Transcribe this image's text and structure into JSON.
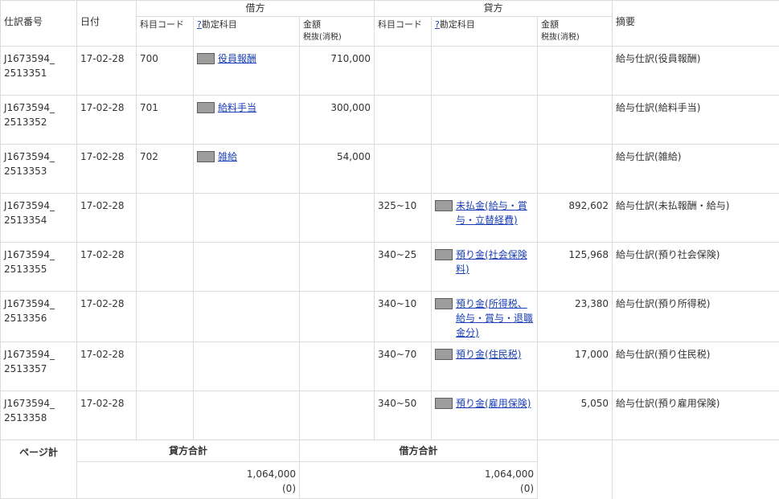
{
  "header": {
    "entry_no": "仕訳番号",
    "date": "日付",
    "debit": "借方",
    "credit": "貸方",
    "summary": "摘要",
    "code": "科目コード",
    "q": "?",
    "account": "勘定科目",
    "amount": "金額",
    "tax": "税抜(消税)"
  },
  "rows": [
    {
      "no1": "J1673594_",
      "no2": "2513351",
      "date": "17-02-28",
      "d_code": "700",
      "d_acct": "役員報酬",
      "d_amt": "710,000",
      "c_code": "",
      "c_acct": "",
      "c_amt": "",
      "summary": "給与仕訳(役員報酬)"
    },
    {
      "no1": "J1673594_",
      "no2": "2513352",
      "date": "17-02-28",
      "d_code": "701",
      "d_acct": "給料手当",
      "d_amt": "300,000",
      "c_code": "",
      "c_acct": "",
      "c_amt": "",
      "summary": "給与仕訳(給料手当)"
    },
    {
      "no1": "J1673594_",
      "no2": "2513353",
      "date": "17-02-28",
      "d_code": "702",
      "d_acct": "雑給",
      "d_amt": "54,000",
      "c_code": "",
      "c_acct": "",
      "c_amt": "",
      "summary": "給与仕訳(雑給)"
    },
    {
      "no1": "J1673594_",
      "no2": "2513354",
      "date": "17-02-28",
      "d_code": "",
      "d_acct": "",
      "d_amt": "",
      "c_code": "325~10",
      "c_acct": "未払金(給与・賞与・立替経費)",
      "c_amt": "892,602",
      "summary": "給与仕訳(未払報酬・給与)"
    },
    {
      "no1": "J1673594_",
      "no2": "2513355",
      "date": "17-02-28",
      "d_code": "",
      "d_acct": "",
      "d_amt": "",
      "c_code": "340~25",
      "c_acct": "預り金(社会保険料)",
      "c_amt": "125,968",
      "summary": "給与仕訳(預り社会保険)"
    },
    {
      "no1": "J1673594_",
      "no2": "2513356",
      "date": "17-02-28",
      "d_code": "",
      "d_acct": "",
      "d_amt": "",
      "c_code": "340~10",
      "c_acct": "預り金(所得税、給与・賞与・退職金分)",
      "c_amt": "23,380",
      "summary": "給与仕訳(預り所得税)"
    },
    {
      "no1": "J1673594_",
      "no2": "2513357",
      "date": "17-02-28",
      "d_code": "",
      "d_acct": "",
      "d_amt": "",
      "c_code": "340~70",
      "c_acct": "預り金(住民税)",
      "c_amt": "17,000",
      "summary": "給与仕訳(預り住民税)"
    },
    {
      "no1": "J1673594_",
      "no2": "2513358",
      "date": "17-02-28",
      "d_code": "",
      "d_acct": "",
      "d_amt": "",
      "c_code": "340~50",
      "c_acct": "預り金(雇用保険)",
      "c_amt": "5,050",
      "summary": "給与仕訳(預り雇用保険)"
    }
  ],
  "footer": {
    "page_total": "ページ計",
    "credit_total_label": "貸方合計",
    "debit_total_label": "借方合計",
    "credit_total": "1,064,000",
    "credit_tax": "(0)",
    "debit_total": "1,064,000",
    "debit_tax": "(0)"
  },
  "colors": {
    "link": "#1a3fb5",
    "border": "#dcdcdc",
    "chip": "#9d9d9d"
  }
}
